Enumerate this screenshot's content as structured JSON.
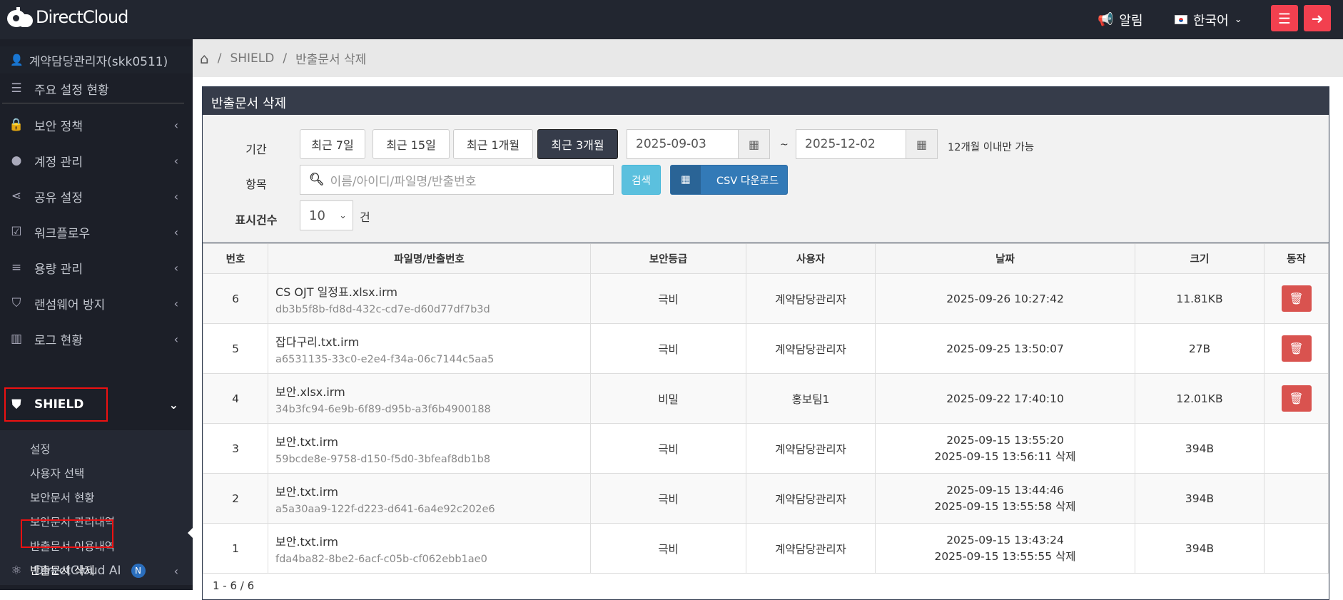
{
  "topbar": {
    "brand": "DirectCloud",
    "notice": "알림",
    "language": "한국어"
  },
  "sidebar": {
    "user": "계약담당관리자(skk0511)",
    "items": [
      {
        "label": "주요 설정 현황"
      },
      {
        "label": "보안 정책"
      },
      {
        "label": "계정 관리"
      },
      {
        "label": "공유 설정"
      },
      {
        "label": "워크플로우"
      },
      {
        "label": "용량 관리"
      },
      {
        "label": "랜섬웨어 방지"
      },
      {
        "label": "로그 현황"
      },
      {
        "label": "SHIELD"
      },
      {
        "label": "DirectCloud AI",
        "badge": "N"
      }
    ],
    "submenu": [
      "설정",
      "사용자 선택",
      "보안문서 현황",
      "보안문서 관리내역",
      "반출문서 이용내역",
      "반출문서 삭제"
    ]
  },
  "breadcrumb": {
    "sep": "/",
    "section": "SHIELD",
    "page": "반출문서 삭제"
  },
  "panel": {
    "title": "반출문서 삭제"
  },
  "filter": {
    "period_label": "기간",
    "periods": [
      "최근 7일",
      "최근 15일",
      "최근 1개월",
      "최근 3개월"
    ],
    "start_date": "2025-09-03",
    "tilde": "~",
    "end_date": "2025-12-02",
    "note": "12개월 이내만 가능",
    "item_label": "항목",
    "search_placeholder": "이름/아이디/파일명/반출번호",
    "search_button": "검색",
    "csv_button": "CSV 다운로드",
    "count_label": "표시건수",
    "count_value": "10",
    "count_unit": "건"
  },
  "table": {
    "headers": [
      "번호",
      "파일명/반출번호",
      "보안등급",
      "사용자",
      "날짜",
      "크기",
      "동작"
    ],
    "rows": [
      {
        "no": "6",
        "file": "CS OJT 일정표.xlsx.irm",
        "id": "db3b5f8b-fd8d-432c-cd7e-d60d77df7b3d",
        "grade": "극비",
        "user": "계약담당관리자",
        "date": "2025-09-26 10:27:42",
        "deleted": "",
        "size": "11.81KB",
        "action": true
      },
      {
        "no": "5",
        "file": "잡다구리.txt.irm",
        "id": "a6531135-33c0-e2e4-f34a-06c7144c5aa5",
        "grade": "극비",
        "user": "계약담당관리자",
        "date": "2025-09-25 13:50:07",
        "deleted": "",
        "size": "27B",
        "action": true
      },
      {
        "no": "4",
        "file": "보안.xlsx.irm",
        "id": "34b3fc94-6e9b-6f89-d95b-a3f6b4900188",
        "grade": "비밀",
        "user": "홍보팀1",
        "date": "2025-09-22 17:40:10",
        "deleted": "",
        "size": "12.01KB",
        "action": true
      },
      {
        "no": "3",
        "file": "보안.txt.irm",
        "id": "59bcde8e-9758-d150-f5d0-3bfeaf8db1b8",
        "grade": "극비",
        "user": "계약담당관리자",
        "date": "2025-09-15 13:55:20",
        "deleted": "2025-09-15 13:56:11 삭제",
        "size": "394B",
        "action": false
      },
      {
        "no": "2",
        "file": "보안.txt.irm",
        "id": "a5a30aa9-122f-d223-d641-6a4e92c202e6",
        "grade": "극비",
        "user": "계약담당관리자",
        "date": "2025-09-15 13:44:46",
        "deleted": "2025-09-15 13:55:58 삭제",
        "size": "394B",
        "action": false
      },
      {
        "no": "1",
        "file": "보안.txt.irm",
        "id": "fda4ba82-8be2-6acf-c05b-cf062ebb1ae0",
        "grade": "극비",
        "user": "계약담당관리자",
        "date": "2025-09-15 13:43:24",
        "deleted": "2025-09-15 13:55:55 삭제",
        "size": "394B",
        "action": false
      }
    ]
  },
  "pager": {
    "text": "1 - 6 / 6"
  },
  "colors": {
    "topbar": "#222630",
    "sidebar": "#1c1f28",
    "accent_red": "#f2404f",
    "delete_red": "#d9534f",
    "csv_blue": "#337ab7",
    "search_cyan": "#5bc0de"
  }
}
